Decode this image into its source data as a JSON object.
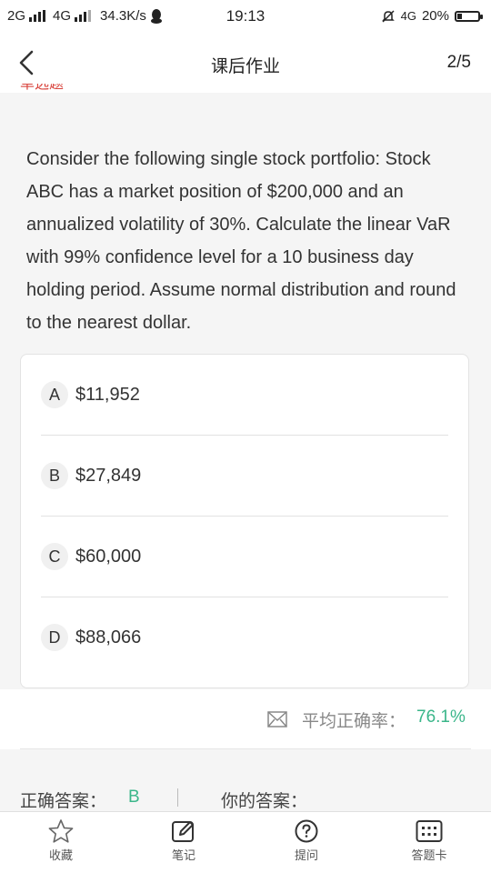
{
  "status_bar": {
    "network1": "2G",
    "network2": "4G",
    "speed": "34.3K/s",
    "time": "19:13",
    "network3": "4G",
    "battery": "20%",
    "battery_level": 0.2
  },
  "nav": {
    "title": "课后作业",
    "page": "2/5",
    "question_type": "单选题"
  },
  "question": {
    "text": "Consider the following single stock portfolio: Stock ABC has a market position of $200,000 and an annualized volatility of 30%. Calculate the linear VaR with 99% confidence level for a 10 business day holding period. Assume normal distribution and round to the nearest dollar.",
    "options": [
      {
        "letter": "A",
        "text": "$11,952"
      },
      {
        "letter": "B",
        "text": "$27,849"
      },
      {
        "letter": "C",
        "text": "$60,000"
      },
      {
        "letter": "D",
        "text": "$88,066"
      }
    ]
  },
  "stats": {
    "avg_rate_label": "平均正确率：",
    "avg_rate_value": "76.1%"
  },
  "answer": {
    "correct_label": "正确答案：",
    "correct_value": "B",
    "your_label": "你的答案："
  },
  "tabs": [
    {
      "label": "收藏",
      "icon": "star-icon"
    },
    {
      "label": "笔记",
      "icon": "edit-icon"
    },
    {
      "label": "提问",
      "icon": "question-icon"
    },
    {
      "label": "答题卡",
      "icon": "grid-card-icon"
    }
  ],
  "colors": {
    "accent_green": "#3bb68a",
    "question_type_red": "#d9463f"
  }
}
